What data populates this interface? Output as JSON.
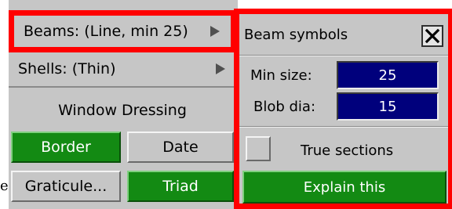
{
  "left_panel": {
    "beams_label": "Beams: (Line, min 25)",
    "shells_label": "Shells: (Thin)",
    "submenu_icon": "triangle-right-icon",
    "window_dressing_label": "Window Dressing",
    "buttons": {
      "border": "Border",
      "date": "Date",
      "graticule": "Graticule...",
      "triad": "Triad"
    },
    "stray_text": "e"
  },
  "beam_symbols": {
    "title": "Beam symbols",
    "close_icon": "close-x-icon",
    "min_size_label": "Min size:",
    "min_size_value": "25",
    "blob_dia_label": "Blob dia:",
    "blob_dia_value": "15",
    "true_sections_label": "True sections",
    "true_sections_checked": false,
    "explain_label": "Explain this"
  },
  "colors": {
    "highlight_red": "#ff0000",
    "panel_grey": "#c6c6c6",
    "active_green": "#138a13",
    "field_blue": "#00007c"
  }
}
